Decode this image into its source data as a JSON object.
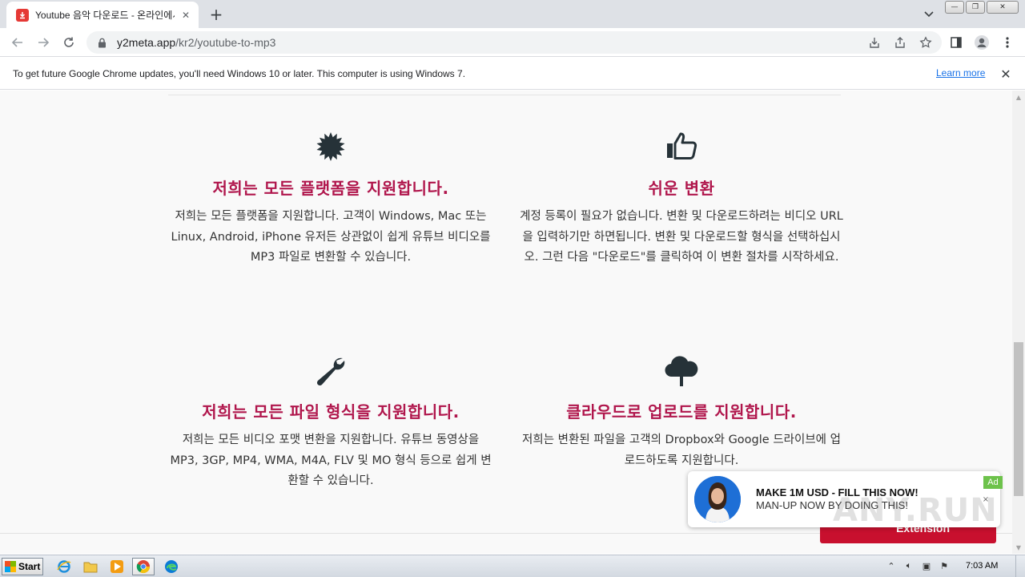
{
  "browser": {
    "tab_title": "Youtube 음악 다운로드 - 온라인에서",
    "url_host": "y2meta.app",
    "url_path": "/kr2/youtube-to-mp3",
    "accent": "#e53935"
  },
  "infobar": {
    "message": "To get future Google Chrome updates, you'll need Windows 10 or later. This computer is using Windows 7.",
    "link": "Learn more"
  },
  "features": [
    {
      "icon": "starburst-icon",
      "title": "저희는 모든 플랫폼을 지원합니다.",
      "desc": "저희는 모든 플랫폼을 지원합니다. 고객이 Windows, Mac 또는 Linux, Android, iPhone 유저든 상관없이 쉽게 유튜브 비디오를 MP3 파일로 변환할 수 있습니다."
    },
    {
      "icon": "thumbs-up-icon",
      "title": "쉬운 변환",
      "desc": "계정 등록이 필요가 없습니다. 변환 및 다운로드하려는 비디오 URL을 입력하기만 하면됩니다. 변환 및 다운로드할 형식을 선택하십시오. 그런 다음 \"다운로드\"를 클릭하여 이 변환 절차를 시작하세요."
    },
    {
      "icon": "wrench-icon",
      "title": "저희는 모든 파일 형식을 지원합니다.",
      "desc": "저희는 모든 비디오 포맷 변환을 지원합니다. 유튜브 동영상을 MP3, 3GP, MP4, WMA, M4A, FLV 및 MO 형식 등으로 쉽게 변환할 수 있습니다."
    },
    {
      "icon": "cloud-upload-icon",
      "title": "클라우드로 업로드를 지원합니다.",
      "desc": "저희는 변환된 파일을 고객의 Dropbox와 Google 드라이브에 업로드하도록 지원합니다."
    }
  ],
  "colors": {
    "feature_title": "#b0164c",
    "extension_button": "#c8102e"
  },
  "extension_button": "Extension",
  "ad": {
    "badge": "Ad",
    "title": "MAKE 1M USD - FILL THIS NOW!",
    "subtitle": "MAN-UP NOW BY DOING THIS!",
    "close": "×"
  },
  "watermark": "ANY.RUN",
  "taskbar": {
    "start": "Start",
    "clock": "7:03 AM"
  }
}
